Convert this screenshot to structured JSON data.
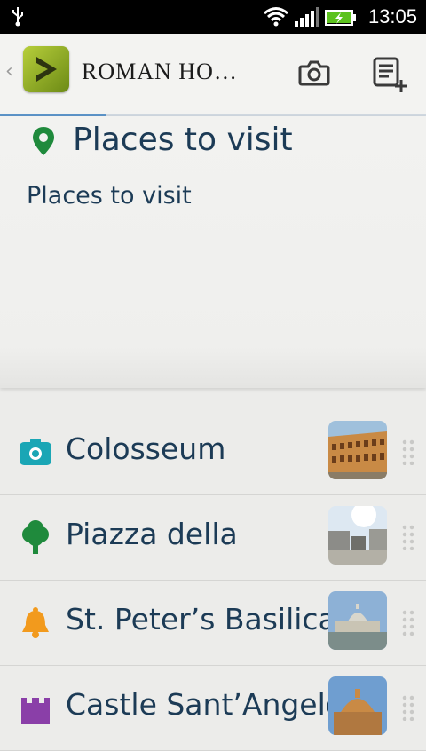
{
  "status_bar": {
    "time": "13:05"
  },
  "app_bar": {
    "title": "ROMAN HO…"
  },
  "section": {
    "title": "Places to visit",
    "description": "Places to visit"
  },
  "places": [
    {
      "label": "Colosseum",
      "icon": "camera-icon"
    },
    {
      "label": "Piazza della",
      "icon": "tree-icon"
    },
    {
      "label": "St. Peter’s Basilica",
      "icon": "bell-icon"
    },
    {
      "label": "Castle Sant’Angelo",
      "icon": "castle-icon"
    }
  ],
  "colors": {
    "accent_blue": "#5b93c7",
    "text_navy": "#1c3b56",
    "logo_green": "#8fb022"
  }
}
